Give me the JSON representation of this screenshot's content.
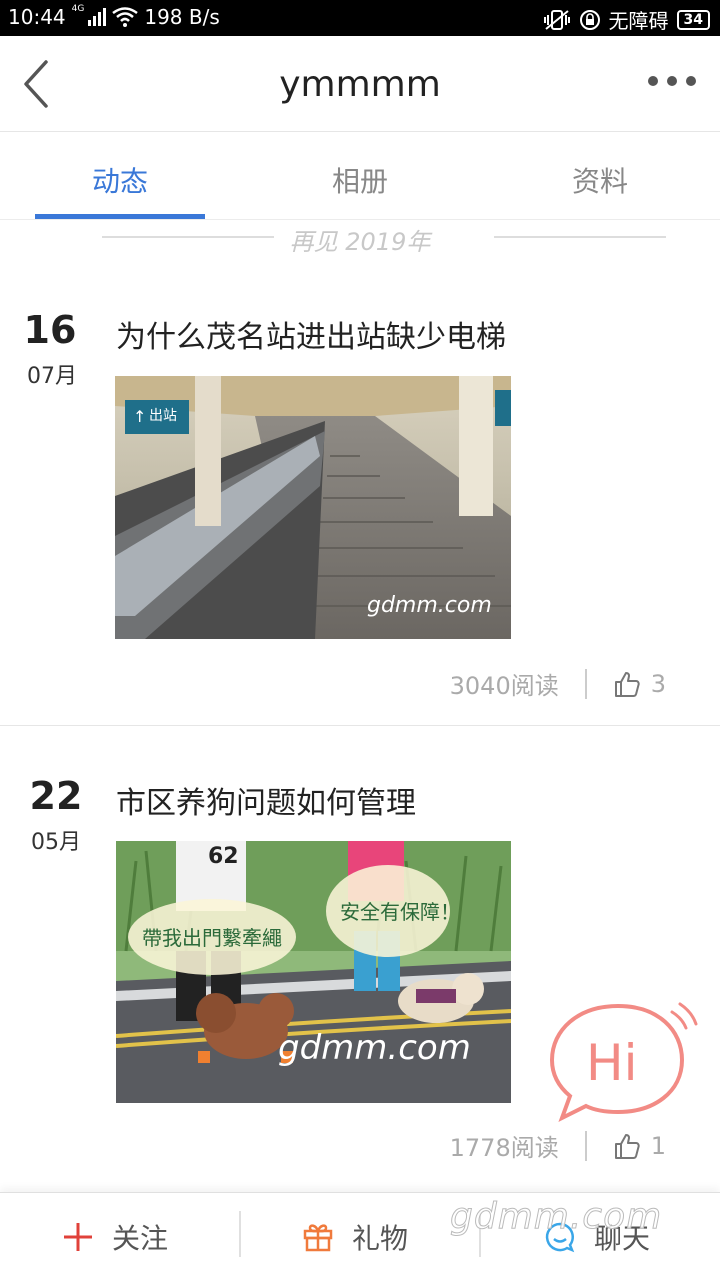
{
  "status_bar": {
    "time": "10:44",
    "network": "4G",
    "speed": "198 B/s",
    "accessibility": "无障碍",
    "battery": "34"
  },
  "nav": {
    "title": "ymmmm"
  },
  "tabs": [
    {
      "label": "动态",
      "active": true
    },
    {
      "label": "相册",
      "active": false
    },
    {
      "label": "资料",
      "active": false
    }
  ],
  "year_divider": "再见 2019年",
  "posts": [
    {
      "day": "16",
      "month": "07月",
      "title": "为什么茂名站进出站缺少电梯",
      "image_watermark": "gdmm.com",
      "image_sign": "出站",
      "reads": "3040阅读",
      "likes": "3"
    },
    {
      "day": "22",
      "month": "05月",
      "title": "市区养狗问题如何管理",
      "image_watermark": "gdmm.com",
      "bubble_left": "帶我出門繫牽繩",
      "bubble_right": "安全有保障！",
      "shirt_number": "62",
      "reads": "1778阅读",
      "likes": "1"
    }
  ],
  "hi_bubble": "Hi",
  "bottom_bar": {
    "follow": "关注",
    "gift": "礼物",
    "chat": "聊天"
  },
  "page_watermark": "gdmm.com",
  "colors": {
    "accent": "#3a78d8",
    "follow_icon": "#e0413a",
    "gift_icon": "#f07a3c",
    "chat_icon": "#3aa6e8",
    "hi_bubble": "#f28b85"
  }
}
